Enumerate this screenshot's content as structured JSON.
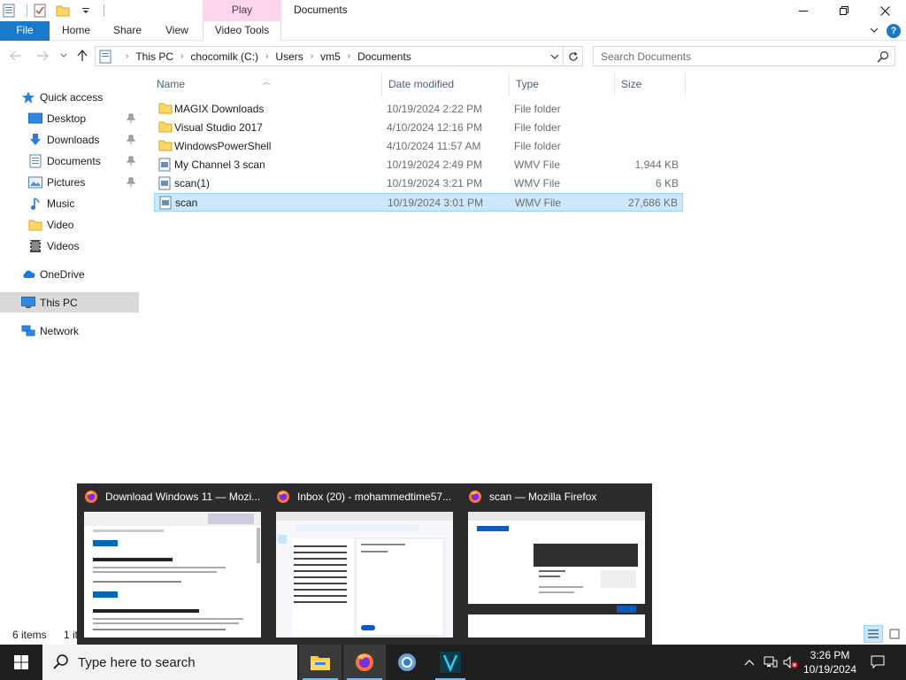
{
  "window": {
    "title": "Documents",
    "context_tab_group": "Play",
    "minimize_label": "Minimize",
    "maximize_label": "Maximize",
    "close_label": "Close"
  },
  "ribbon": {
    "tabs": [
      {
        "label": "File"
      },
      {
        "label": "Home"
      },
      {
        "label": "Share"
      },
      {
        "label": "View"
      },
      {
        "label": "Video Tools"
      }
    ]
  },
  "address": {
    "crumbs": [
      "This PC",
      "chocomilk (C:)",
      "Users",
      "vm5",
      "Documents"
    ]
  },
  "search": {
    "placeholder": "Search Documents"
  },
  "sidebar": {
    "quick_access": "Quick access",
    "items": [
      {
        "label": "Desktop",
        "icon": "desktop-icon",
        "pinned": true
      },
      {
        "label": "Downloads",
        "icon": "downloads-icon",
        "pinned": true
      },
      {
        "label": "Documents",
        "icon": "documents-icon",
        "pinned": true
      },
      {
        "label": "Pictures",
        "icon": "pictures-icon",
        "pinned": true
      },
      {
        "label": "Music",
        "icon": "music-icon",
        "pinned": false
      },
      {
        "label": "Video",
        "icon": "folder-icon",
        "pinned": false
      },
      {
        "label": "Videos",
        "icon": "videos-icon",
        "pinned": false
      }
    ],
    "onedrive": "OneDrive",
    "thispc": "This PC",
    "network": "Network"
  },
  "columns": {
    "name": "Name",
    "date": "Date modified",
    "type": "Type",
    "size": "Size"
  },
  "files": [
    {
      "name": "MAGIX Downloads",
      "date": "10/19/2024 2:22 PM",
      "type": "File folder",
      "size": "",
      "kind": "folder"
    },
    {
      "name": "Visual Studio 2017",
      "date": "4/10/2024 12:16 PM",
      "type": "File folder",
      "size": "",
      "kind": "folder"
    },
    {
      "name": "WindowsPowerShell",
      "date": "4/10/2024 11:57 AM",
      "type": "File folder",
      "size": "",
      "kind": "folder"
    },
    {
      "name": "My Channel 3 scan",
      "date": "10/19/2024 2:49 PM",
      "type": "WMV File",
      "size": "1,944 KB",
      "kind": "wmv"
    },
    {
      "name": "scan(1)",
      "date": "10/19/2024 3:21 PM",
      "type": "WMV File",
      "size": "6 KB",
      "kind": "wmv"
    },
    {
      "name": "scan",
      "date": "10/19/2024 3:01 PM",
      "type": "WMV File",
      "size": "27,686 KB",
      "kind": "wmv",
      "selected": true
    }
  ],
  "status": {
    "count": "6 items",
    "selected_partial": "1 it"
  },
  "previews": [
    {
      "title": "Download Windows 11 — Mozi..."
    },
    {
      "title": "Inbox (20) - mohammedtime57..."
    },
    {
      "title": "scan — Mozilla Firefox"
    }
  ],
  "taskbar": {
    "search_placeholder": "Type here to search",
    "time": "3:26 PM",
    "date": "10/19/2024"
  },
  "colors": {
    "accent": "#1979ca",
    "selection": "#cce8ff",
    "taskbar": "#1f1f1f",
    "context_tab": "#fcd4ec"
  }
}
